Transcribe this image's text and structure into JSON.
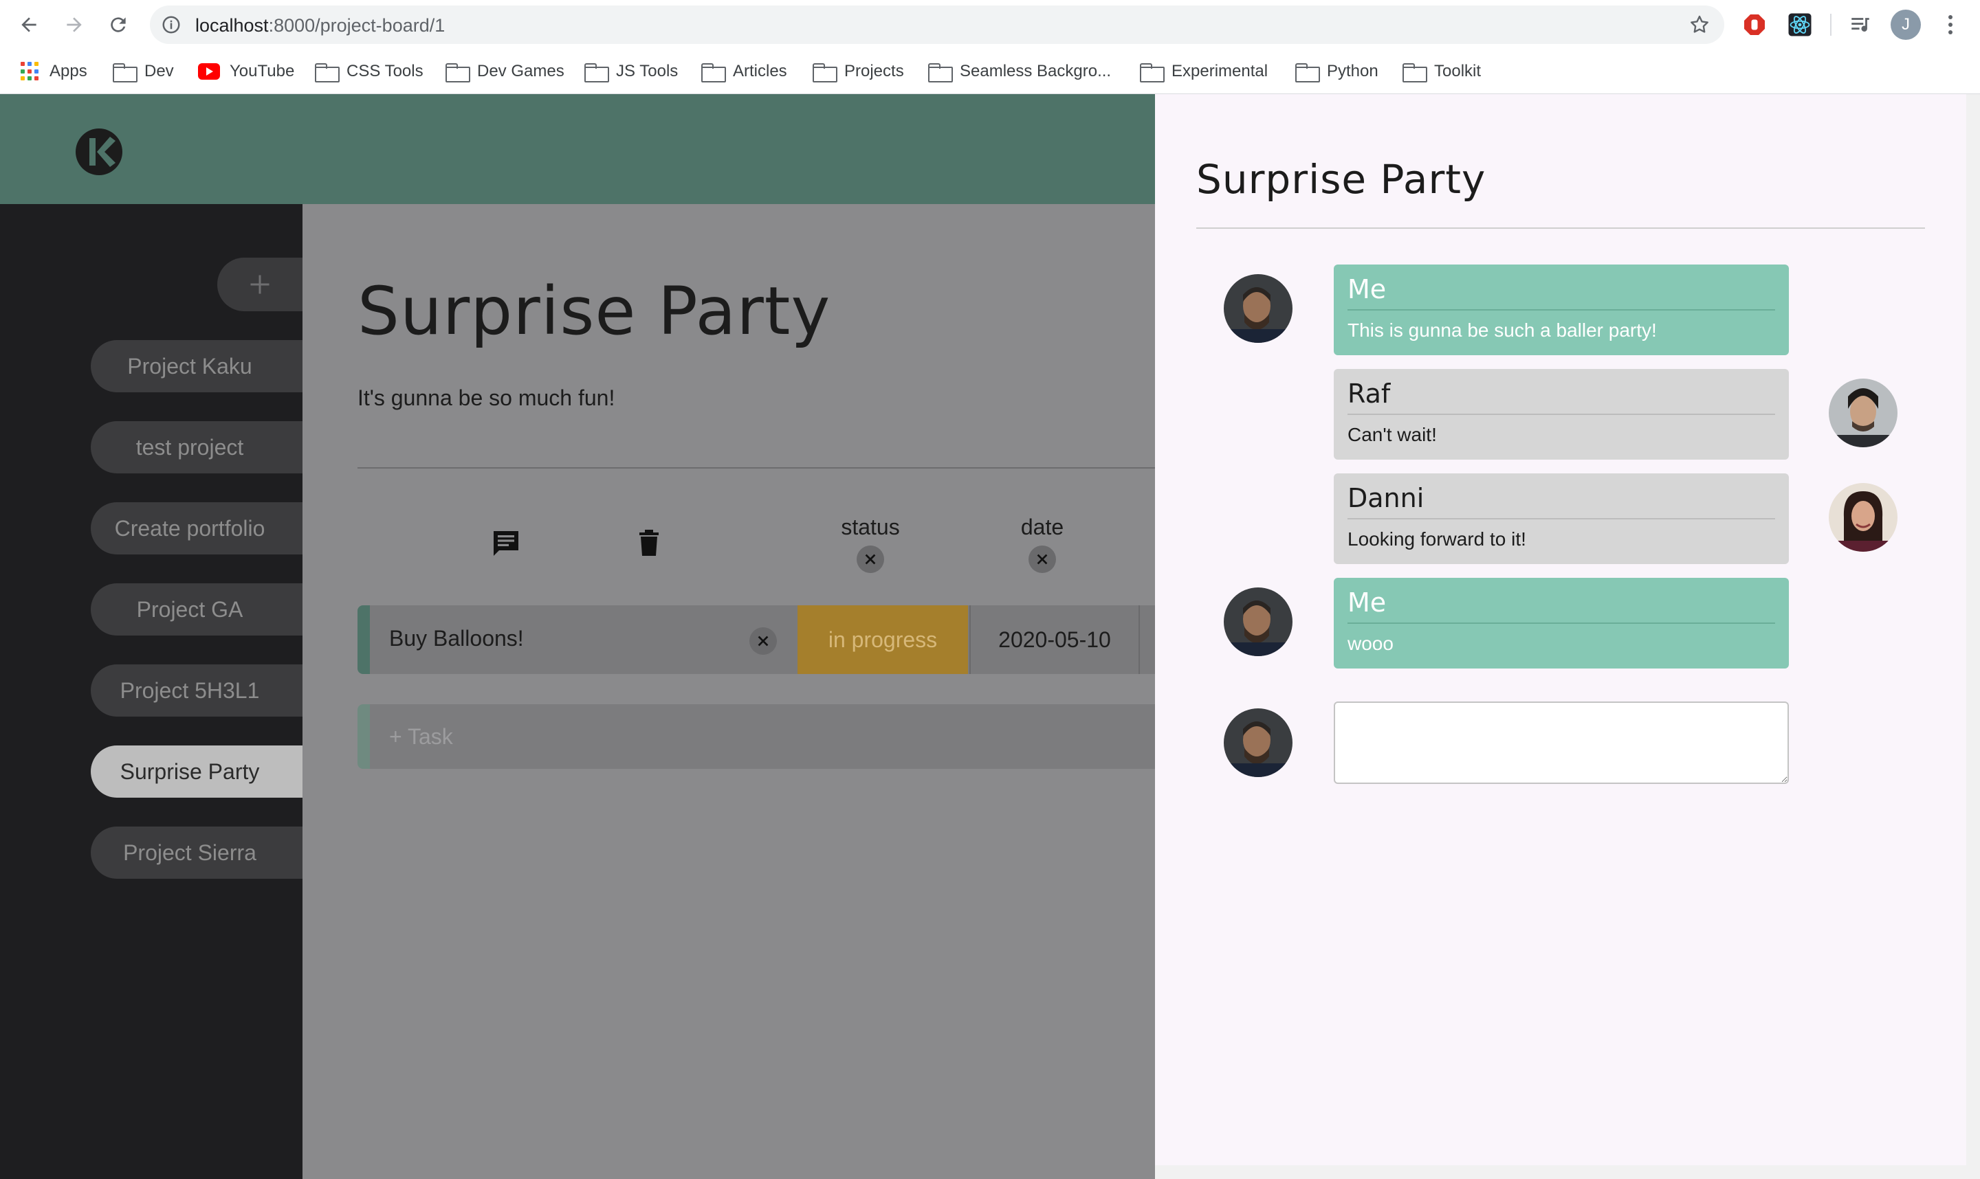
{
  "browser": {
    "url_host": "localhost",
    "url_path": ":8000/project-board/1",
    "profile_initial": "J"
  },
  "bookmarks": [
    {
      "label": "Apps",
      "icon": "apps-grid-icon"
    },
    {
      "label": "Dev",
      "icon": "folder-icon"
    },
    {
      "label": "YouTube",
      "icon": "youtube-icon"
    },
    {
      "label": "CSS Tools",
      "icon": "folder-icon"
    },
    {
      "label": "Dev Games",
      "icon": "folder-icon"
    },
    {
      "label": "JS Tools",
      "icon": "folder-icon"
    },
    {
      "label": "Articles",
      "icon": "folder-icon"
    },
    {
      "label": "Projects",
      "icon": "folder-icon"
    },
    {
      "label": "Seamless Backgro...",
      "icon": "folder-icon"
    },
    {
      "label": "Experimental",
      "icon": "folder-icon"
    },
    {
      "label": "Python",
      "icon": "folder-icon"
    },
    {
      "label": "Toolkit",
      "icon": "folder-icon"
    }
  ],
  "sidebar": {
    "projects": [
      {
        "label": "Project Kaku",
        "active": false
      },
      {
        "label": "test project",
        "active": false
      },
      {
        "label": "Create portfolio",
        "active": false
      },
      {
        "label": "Project GA",
        "active": false
      },
      {
        "label": "Project 5H3L1",
        "active": false
      },
      {
        "label": "Surprise Party",
        "active": true
      },
      {
        "label": "Project Sierra",
        "active": false
      }
    ]
  },
  "board": {
    "title": "Surprise Party",
    "description": "It's gunna be so much fun!",
    "columns": {
      "status": "status",
      "date": "date"
    },
    "tasks": [
      {
        "name": "Buy Balloons!",
        "status": "in progress",
        "date": "2020-05-10"
      }
    ],
    "add_task_label": "+ Task"
  },
  "chat": {
    "title": "Surprise Party",
    "messages": [
      {
        "author": "Me",
        "text": "This is gunna be such a baller party!",
        "mine": true
      },
      {
        "author": "Raf",
        "text": "Can't wait!",
        "mine": false
      },
      {
        "author": "Danni",
        "text": "Looking forward to it!",
        "mine": false
      },
      {
        "author": "Me",
        "text": "wooo",
        "mine": true
      }
    ],
    "input_value": ""
  },
  "colors": {
    "header": "#4e7368",
    "sidebar": "#1e1e20",
    "status_in_progress": "#a57f2c",
    "my_message": "#86c8b4",
    "other_message": "#d6d6d6"
  }
}
